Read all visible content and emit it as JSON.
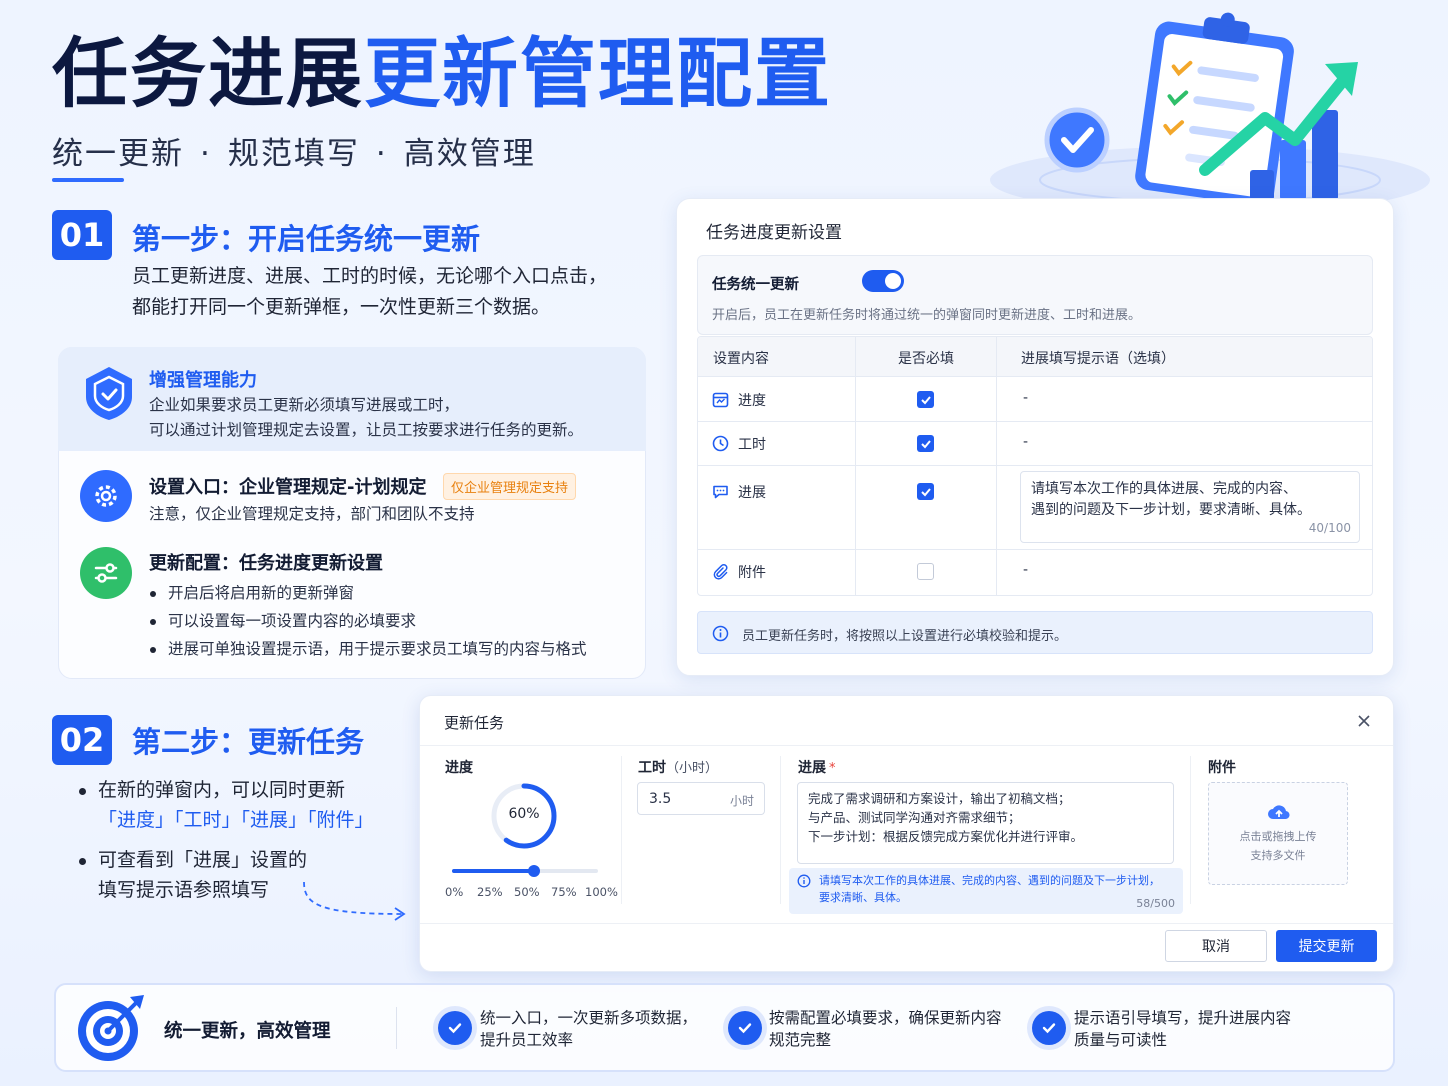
{
  "header": {
    "title_dark": "任务进展",
    "title_blue": "更新管理配置",
    "subtitle": [
      "统一更新",
      "规范填写",
      "高效管理"
    ],
    "subtitle_sep": "·"
  },
  "step1": {
    "badge": "01",
    "title": "第一步：开启任务统一更新",
    "desc_line1": "员工更新进度、进展、工时的时候，无论哪个入口点击，",
    "desc_line2": "都能打开同一个更新弹框，一次性更新三个数据。"
  },
  "features": {
    "enhance": {
      "title": "增强管理能力",
      "line1": "企业如果要求员工更新必须填写进展或工时，",
      "line2": "可以通过计划管理规定去设置，让员工按要求进行任务的更新。"
    },
    "entry": {
      "title": "设置入口：企业管理规定-计划规定",
      "tag": "仅企业管理规定支持",
      "line1": "注意，仅企业管理规定支持，部门和团队不支持"
    },
    "config": {
      "title": "更新配置：任务进度更新设置",
      "bullets": [
        "开启后将启用新的更新弹窗",
        "可以设置每一项设置内容的必填要求",
        "进展可单独设置提示语，用于提示要求员工填写的内容与格式"
      ]
    }
  },
  "settings_panel": {
    "title": "任务进度更新设置",
    "toggle_label": "任务统一更新",
    "toggle_on": true,
    "toggle_desc": "开启后，员工在更新任务时将通过统一的弹窗同时更新进度、工时和进展。",
    "columns": [
      "设置内容",
      "是否必填",
      "进展填写提示语（选填）"
    ],
    "rows": [
      {
        "icon": "calendar-icon",
        "label": "进度",
        "required": true,
        "hint": "-"
      },
      {
        "icon": "clock-icon",
        "label": "工时",
        "required": true,
        "hint": "-"
      },
      {
        "icon": "chat-icon",
        "label": "进展",
        "required": true,
        "hint": "请填写本次工作的具体进展、完成的内容、遇到的问题及下一步计划，要求清晰、具体。",
        "hint_line1": "请填写本次工作的具体进展、完成的内容、",
        "hint_line2": "遇到的问题及下一步计划，要求清晰、具体。",
        "count": "40/100"
      },
      {
        "icon": "paperclip-icon",
        "label": "附件",
        "required": false,
        "hint": "-"
      }
    ],
    "info": "员工更新任务时，将按照以上设置进行必填校验和提示。"
  },
  "step2": {
    "badge": "02",
    "title": "第二步：更新任务",
    "bullet1_line1": "在新的弹窗内，可以同时更新",
    "bullet1_line2": "「进度」「工时」「进展」「附件」",
    "bullet2_line1": "可查看到「进展」设置的",
    "bullet2_line2": "填写提示语参照填写"
  },
  "dialog": {
    "title": "更新任务",
    "progress": {
      "label": "进度",
      "value_text": "60%",
      "value": 0.6,
      "slider_value": 0.56,
      "scale": [
        "0%",
        "25%",
        "50%",
        "75%",
        "100%"
      ]
    },
    "hours": {
      "label": "工时",
      "unit_label": "（小时）",
      "value": "3.5",
      "suffix": "小时"
    },
    "progress_note": {
      "label": "进展",
      "required_mark": "*",
      "line1": "完成了需求调研和方案设计，输出了初稿文档；",
      "line2": "与产品、测试同学沟通对齐需求细节；",
      "line3": "下一步计划：根据反馈完成方案优化并进行评审。",
      "hint_line1": "请填写本次工作的具体进展、完成的内容、遇到的问题及下一步计划，",
      "hint_line2": "要求清晰、具体。",
      "count": "58/500"
    },
    "attachment": {
      "label": "附件",
      "line1": "点击或拖拽上传",
      "line2": "支持多文件"
    },
    "cancel": "取消",
    "submit": "提交更新"
  },
  "bottom": {
    "title": "统一更新，高效管理",
    "items": [
      {
        "line1": "统一入口，一次更新多项数据，",
        "line2": "提升员工效率"
      },
      {
        "line1": "按需配置必填要求，确保更新内容",
        "line2": "规范完整"
      },
      {
        "line1": "提示语引导填写，提升进展内容",
        "line2": "质量与可读性"
      }
    ]
  },
  "colors": {
    "primary": "#1f5cf0",
    "navy": "#0c1840",
    "green": "#2fbf6a",
    "orange": "#e8800e"
  }
}
